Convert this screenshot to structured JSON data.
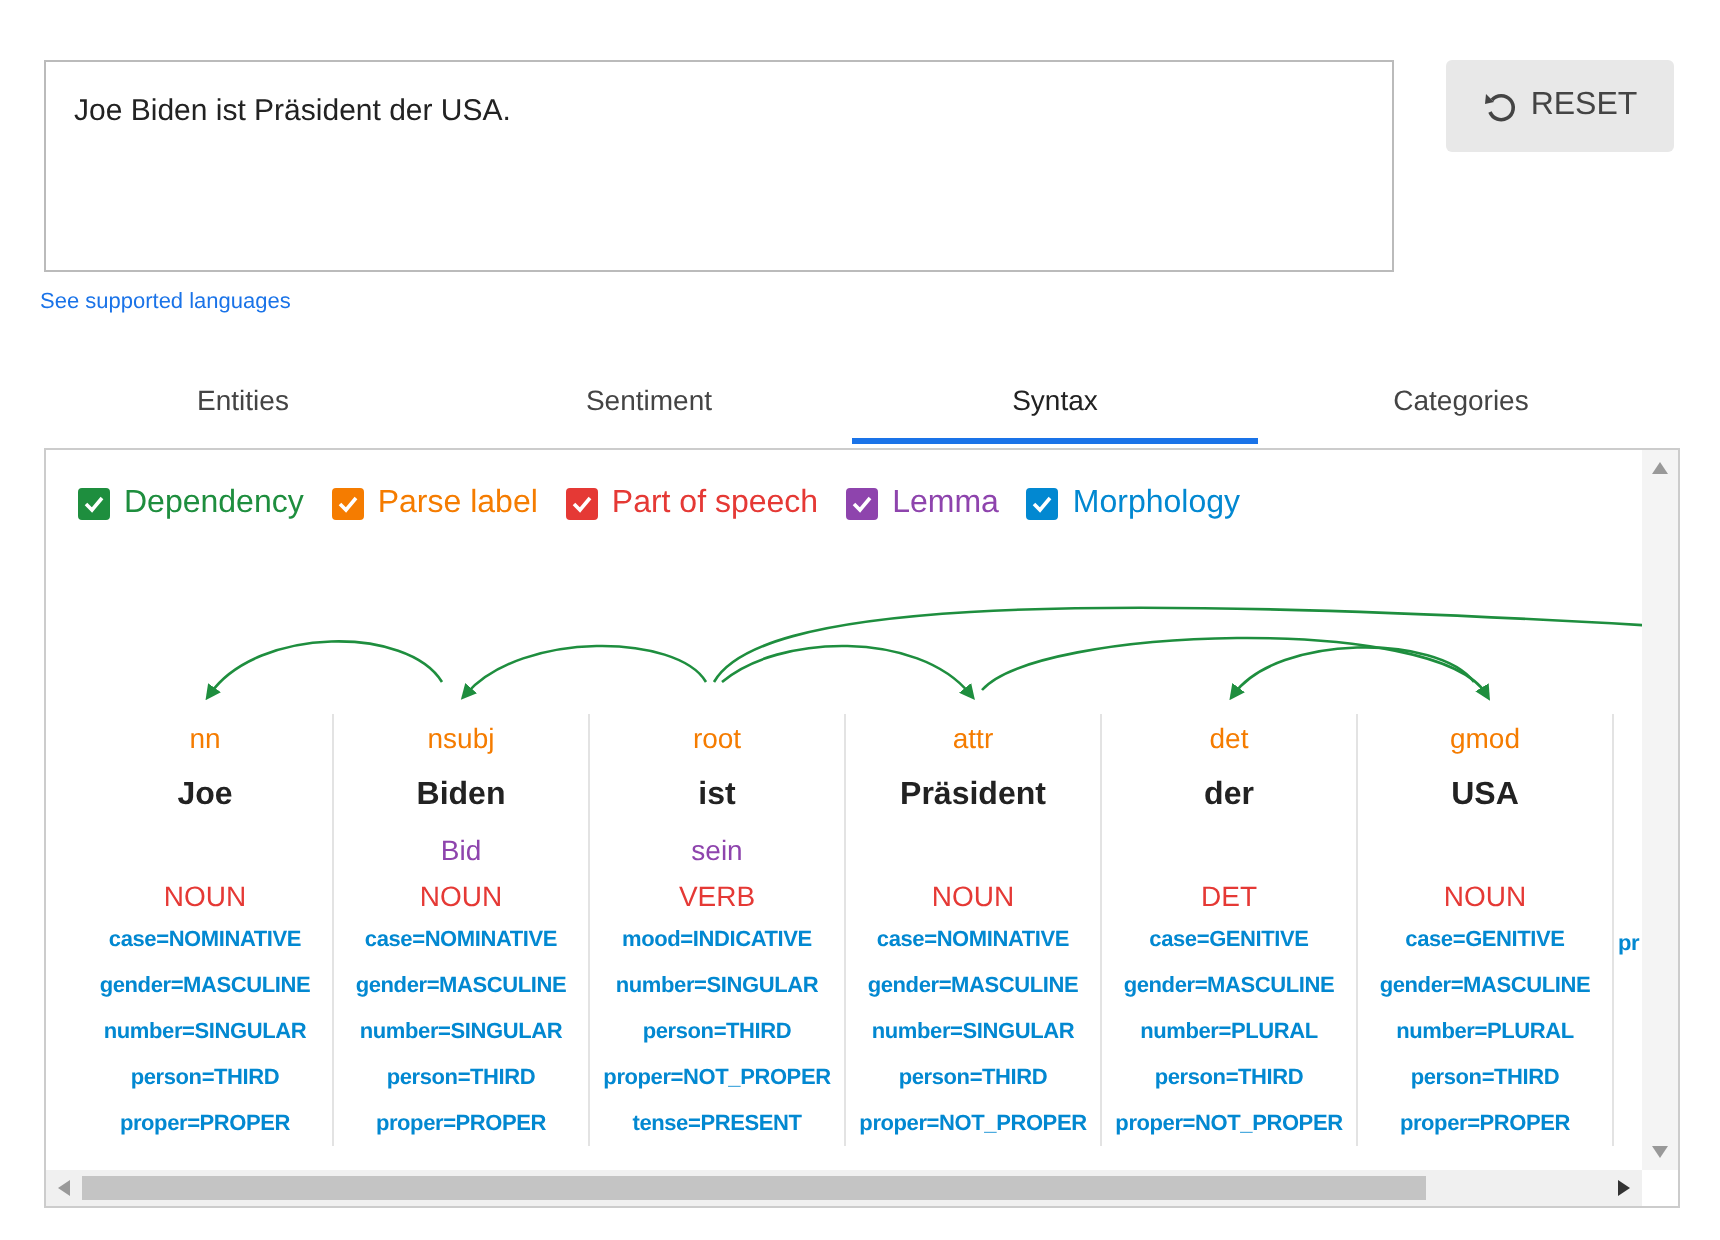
{
  "input": {
    "value": "Joe Biden ist Präsident der USA."
  },
  "reset_button": {
    "label": "RESET"
  },
  "languages_link": "See supported languages",
  "tabs": [
    {
      "label": "Entities",
      "selected": false
    },
    {
      "label": "Sentiment",
      "selected": false
    },
    {
      "label": "Syntax",
      "selected": true
    },
    {
      "label": "Categories",
      "selected": false
    }
  ],
  "legend": [
    {
      "kind": "dependency",
      "label": "Dependency",
      "checked": true,
      "color": "#1e8e3e"
    },
    {
      "kind": "label",
      "label": "Parse label",
      "checked": true,
      "color": "#f57c00"
    },
    {
      "kind": "pos",
      "label": "Part of speech",
      "checked": true,
      "color": "#e53935"
    },
    {
      "kind": "lemma",
      "label": "Lemma",
      "checked": true,
      "color": "#8e44ad"
    },
    {
      "kind": "morphology",
      "label": "Morphology",
      "checked": true,
      "color": "#0288d1"
    }
  ],
  "tokens": [
    {
      "label": "nn",
      "word": "Joe",
      "pos": "NOUN",
      "morphology": [
        "case=NOMINATIVE",
        "gender=MASCULINE",
        "number=SINGULAR",
        "person=THIRD",
        "proper=PROPER"
      ]
    },
    {
      "label": "nsubj",
      "word": "Biden",
      "lemma": "Bid",
      "pos": "NOUN",
      "morphology": [
        "case=NOMINATIVE",
        "gender=MASCULINE",
        "number=SINGULAR",
        "person=THIRD",
        "proper=PROPER"
      ]
    },
    {
      "label": "root",
      "word": "ist",
      "lemma": "sein",
      "pos": "VERB",
      "morphology": [
        "mood=INDICATIVE",
        "number=SINGULAR",
        "person=THIRD",
        "proper=NOT_PROPER",
        "tense=PRESENT"
      ]
    },
    {
      "label": "attr",
      "word": "Präsident",
      "pos": "NOUN",
      "morphology": [
        "case=NOMINATIVE",
        "gender=MASCULINE",
        "number=SINGULAR",
        "person=THIRD",
        "proper=NOT_PROPER"
      ]
    },
    {
      "label": "det",
      "word": "der",
      "pos": "DET",
      "morphology": [
        "case=GENITIVE",
        "gender=MASCULINE",
        "number=PLURAL",
        "person=THIRD",
        "proper=NOT_PROPER"
      ]
    },
    {
      "label": "gmod",
      "word": "USA",
      "pos": "NOUN",
      "morphology": [
        "case=GENITIVE",
        "gender=MASCULINE",
        "number=PLURAL",
        "person=THIRD",
        "proper=PROPER"
      ]
    },
    {
      "morphology": [
        "pr"
      ]
    }
  ]
}
